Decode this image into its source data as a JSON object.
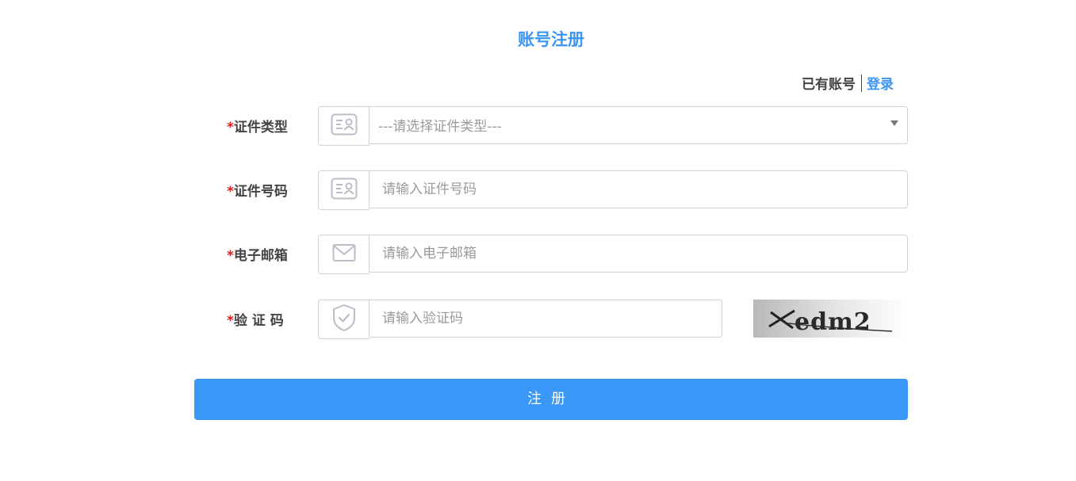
{
  "page": {
    "title": "账号注册"
  },
  "login": {
    "have_account": "已有账号",
    "link": "登录"
  },
  "form": {
    "required_mark": "*",
    "id_type": {
      "label": "证件类型",
      "placeholder": "---请选择证件类型---",
      "icon": "id-card-icon"
    },
    "id_number": {
      "label": "证件号码",
      "placeholder": "请输入证件号码",
      "icon": "id-card-icon"
    },
    "email": {
      "label": "电子邮箱",
      "placeholder": "请输入电子邮箱",
      "icon": "envelope-icon"
    },
    "captcha": {
      "label": "验 证 码",
      "placeholder": "请输入验证码",
      "icon": "shield-check-icon",
      "image_text": "Xedm2"
    }
  },
  "submit": {
    "label": "注册"
  },
  "colors": {
    "accent": "#3a95f5",
    "required": "#e02020",
    "border": "#cfd3d9",
    "placeholder": "#9a9a9a"
  }
}
